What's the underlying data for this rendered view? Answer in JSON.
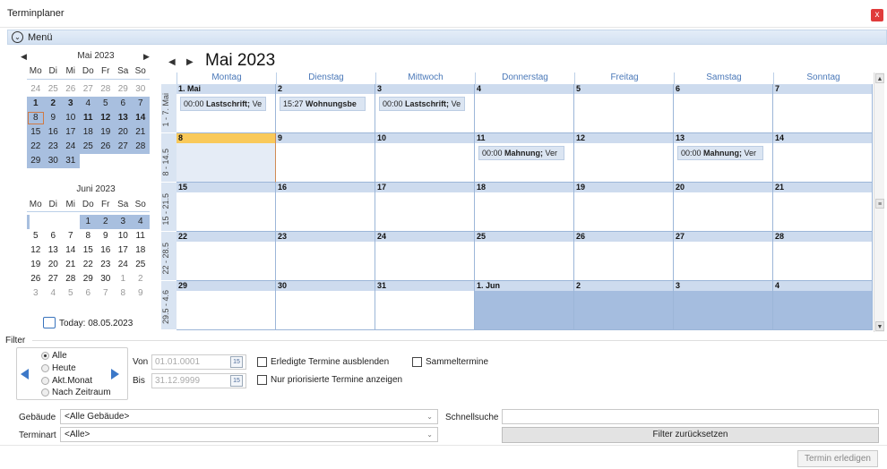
{
  "window": {
    "title": "Terminplaner",
    "close": "x"
  },
  "menu": {
    "label": "Menü"
  },
  "mini1": {
    "title": "Mai 2023",
    "weekdays": [
      "Mo",
      "Di",
      "Mi",
      "Do",
      "Fr",
      "Sa",
      "So"
    ],
    "days": [
      "24",
      "25",
      "26",
      "27",
      "28",
      "29",
      "30",
      "1",
      "2",
      "3",
      "4",
      "5",
      "6",
      "7",
      "8",
      "9",
      "10",
      "11",
      "12",
      "13",
      "14",
      "15",
      "16",
      "17",
      "18",
      "19",
      "20",
      "21",
      "22",
      "23",
      "24",
      "25",
      "26",
      "27",
      "28",
      "29",
      "30",
      "31"
    ]
  },
  "mini2": {
    "title": "Juni 2023",
    "weekdays": [
      "Mo",
      "Di",
      "Mi",
      "Do",
      "Fr",
      "Sa",
      "So"
    ],
    "days": [
      "1",
      "2",
      "3",
      "4",
      "5",
      "6",
      "7",
      "8",
      "9",
      "10",
      "11",
      "12",
      "13",
      "14",
      "15",
      "16",
      "17",
      "18",
      "19",
      "20",
      "21",
      "22",
      "23",
      "24",
      "25",
      "26",
      "27",
      "28",
      "29",
      "30",
      "1",
      "2",
      "3",
      "4",
      "5",
      "6",
      "7",
      "8",
      "9"
    ]
  },
  "today_label": "Today: 08.05.2023",
  "calendar": {
    "title": "Mai 2023",
    "weekdays": [
      "Montag",
      "Dienstag",
      "Mittwoch",
      "Donnerstag",
      "Freitag",
      "Samstag",
      "Sonntag"
    ],
    "weeks": [
      "1 - 7. Mai",
      "8 - 14.5",
      "15 - 21.5",
      "22 - 28.5",
      "29.5 - 4.6"
    ],
    "dates": [
      [
        "1. Mai",
        "2",
        "3",
        "4",
        "5",
        "6",
        "7"
      ],
      [
        "8",
        "9",
        "10",
        "11",
        "12",
        "13",
        "14"
      ],
      [
        "15",
        "16",
        "17",
        "18",
        "19",
        "20",
        "21"
      ],
      [
        "22",
        "23",
        "24",
        "25",
        "26",
        "27",
        "28"
      ],
      [
        "29",
        "30",
        "31",
        "1. Jun",
        "2",
        "3",
        "4"
      ]
    ],
    "appointments": [
      {
        "time": "00:00",
        "title": "Lastschrift;",
        "rest": " Ve"
      },
      {
        "time": "15:27",
        "title": "Wohnungsbe",
        "rest": ""
      },
      {
        "time": "00:00",
        "title": "Lastschrift;",
        "rest": " Ve"
      },
      {
        "time": "00:00",
        "title": "Mahnung;",
        "rest": " Ver"
      },
      {
        "time": "00:00",
        "title": "Mahnung;",
        "rest": " Ver"
      }
    ]
  },
  "filter": {
    "label": "Filter",
    "radios": [
      "Alle",
      "Heute",
      "Akt.Monat",
      "Nach Zeitraum"
    ],
    "von_label": "Von",
    "von_value": "01.01.0001",
    "bis_label": "Bis",
    "bis_value": "31.12.9999",
    "cal_icon": "15",
    "chk1": "Erledigte Termine ausblenden",
    "chk2": "Nur priorisierte Termine anzeigen",
    "chk3": "Sammeltermine",
    "gebaeude_label": "Gebäude",
    "gebaeude_value": "<Alle Gebäude>",
    "terminart_label": "Terminart",
    "terminart_value": "<Alle>",
    "schnellsuche_label": "Schnellsuche",
    "reset_label": "Filter zurücksetzen",
    "done_label": "Termin erledigen"
  }
}
